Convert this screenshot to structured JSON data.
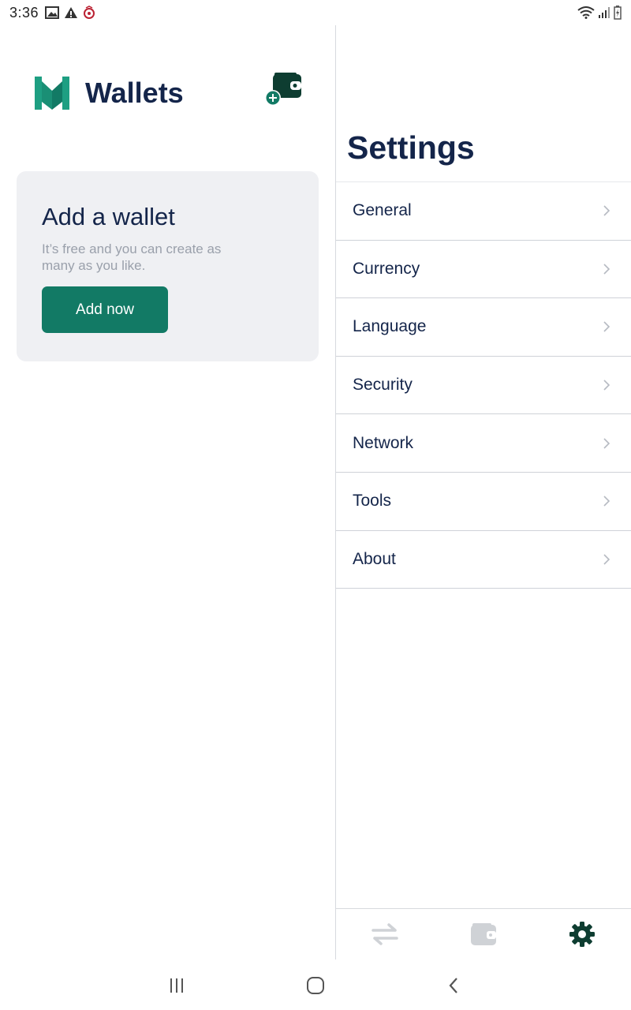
{
  "status_bar": {
    "time": "3:36",
    "left_icons": [
      "image-icon",
      "warning-icon",
      "app-notification-icon"
    ],
    "right_icons": [
      "wifi-icon",
      "signal-icon",
      "battery-charging-icon"
    ]
  },
  "wallets": {
    "title": "Wallets",
    "add_wallet_icon": "wallet-add-icon",
    "card": {
      "title": "Add a wallet",
      "subtitle": "It’s free and you can create as many as you like.",
      "button_label": "Add now"
    }
  },
  "settings": {
    "title": "Settings",
    "items": [
      {
        "label": "General"
      },
      {
        "label": "Currency"
      },
      {
        "label": "Language"
      },
      {
        "label": "Security"
      },
      {
        "label": "Network"
      },
      {
        "label": "Tools"
      },
      {
        "label": "About"
      }
    ]
  },
  "tabs": [
    {
      "icon": "transfer-arrows-icon",
      "active": false
    },
    {
      "icon": "wallet-icon",
      "active": false
    },
    {
      "icon": "gear-icon",
      "active": true
    }
  ],
  "system_nav": [
    "recent-apps-icon",
    "home-icon",
    "back-icon"
  ],
  "colors": {
    "brand_green": "#127a65",
    "text_navy": "#14254a",
    "card_bg": "#eff0f3",
    "muted_text": "#9aa0ab"
  }
}
